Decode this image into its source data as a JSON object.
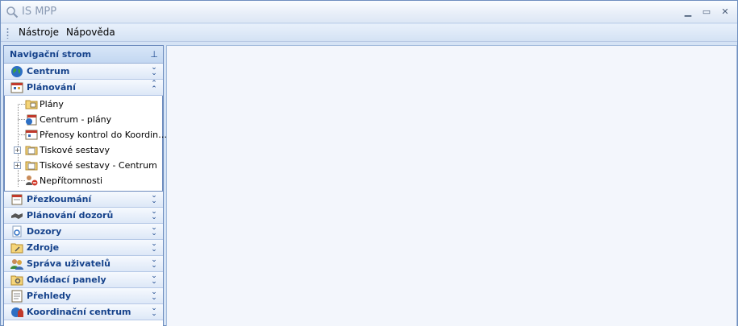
{
  "window": {
    "title": "IS MPP",
    "icons": {
      "app": "search-icon",
      "minimize": "minimize-icon",
      "maximize": "maximize-icon",
      "close": "close-icon"
    }
  },
  "menubar": {
    "items": [
      "Nástroje",
      "Nápověda"
    ]
  },
  "nav": {
    "header": "Navigační strom",
    "groups_top": [
      {
        "label": "Centrum",
        "icon": "globe-icon",
        "state": "collapsed"
      },
      {
        "label": "Plánování",
        "icon": "calendar-icon",
        "state": "expanded"
      }
    ],
    "tree": [
      {
        "label": "Plány",
        "icon": "folder-icon",
        "expandable": false
      },
      {
        "label": "Centrum - plány",
        "icon": "globe-document-icon",
        "expandable": false
      },
      {
        "label": "Přenosy kontrol do Koordin…",
        "icon": "calendar-icon",
        "expandable": false
      },
      {
        "label": "Tiskové sestavy",
        "icon": "folder-report-icon",
        "expandable": true
      },
      {
        "label": "Tiskové sestavy - Centrum",
        "icon": "folder-report-icon",
        "expandable": true
      },
      {
        "label": "Nepřítomnosti",
        "icon": "users-absence-icon",
        "expandable": false
      }
    ],
    "groups_bottom": [
      {
        "label": "Přezkoumání",
        "icon": "document-icon"
      },
      {
        "label": "Plánování dozorů",
        "icon": "handshake-icon"
      },
      {
        "label": "Dozory",
        "icon": "document-magnify-icon"
      },
      {
        "label": "Zdroje",
        "icon": "folder-tools-icon"
      },
      {
        "label": "Správa uživatelů",
        "icon": "users-icon"
      },
      {
        "label": "Ovládací panely",
        "icon": "folder-settings-icon"
      },
      {
        "label": "Přehledy",
        "icon": "report-icon"
      },
      {
        "label": "Koordinační centrum",
        "icon": "globe-house-icon"
      }
    ]
  },
  "colors": {
    "accent": "#15428b",
    "background": "#d5e3f5",
    "content": "#f3f6fc"
  }
}
